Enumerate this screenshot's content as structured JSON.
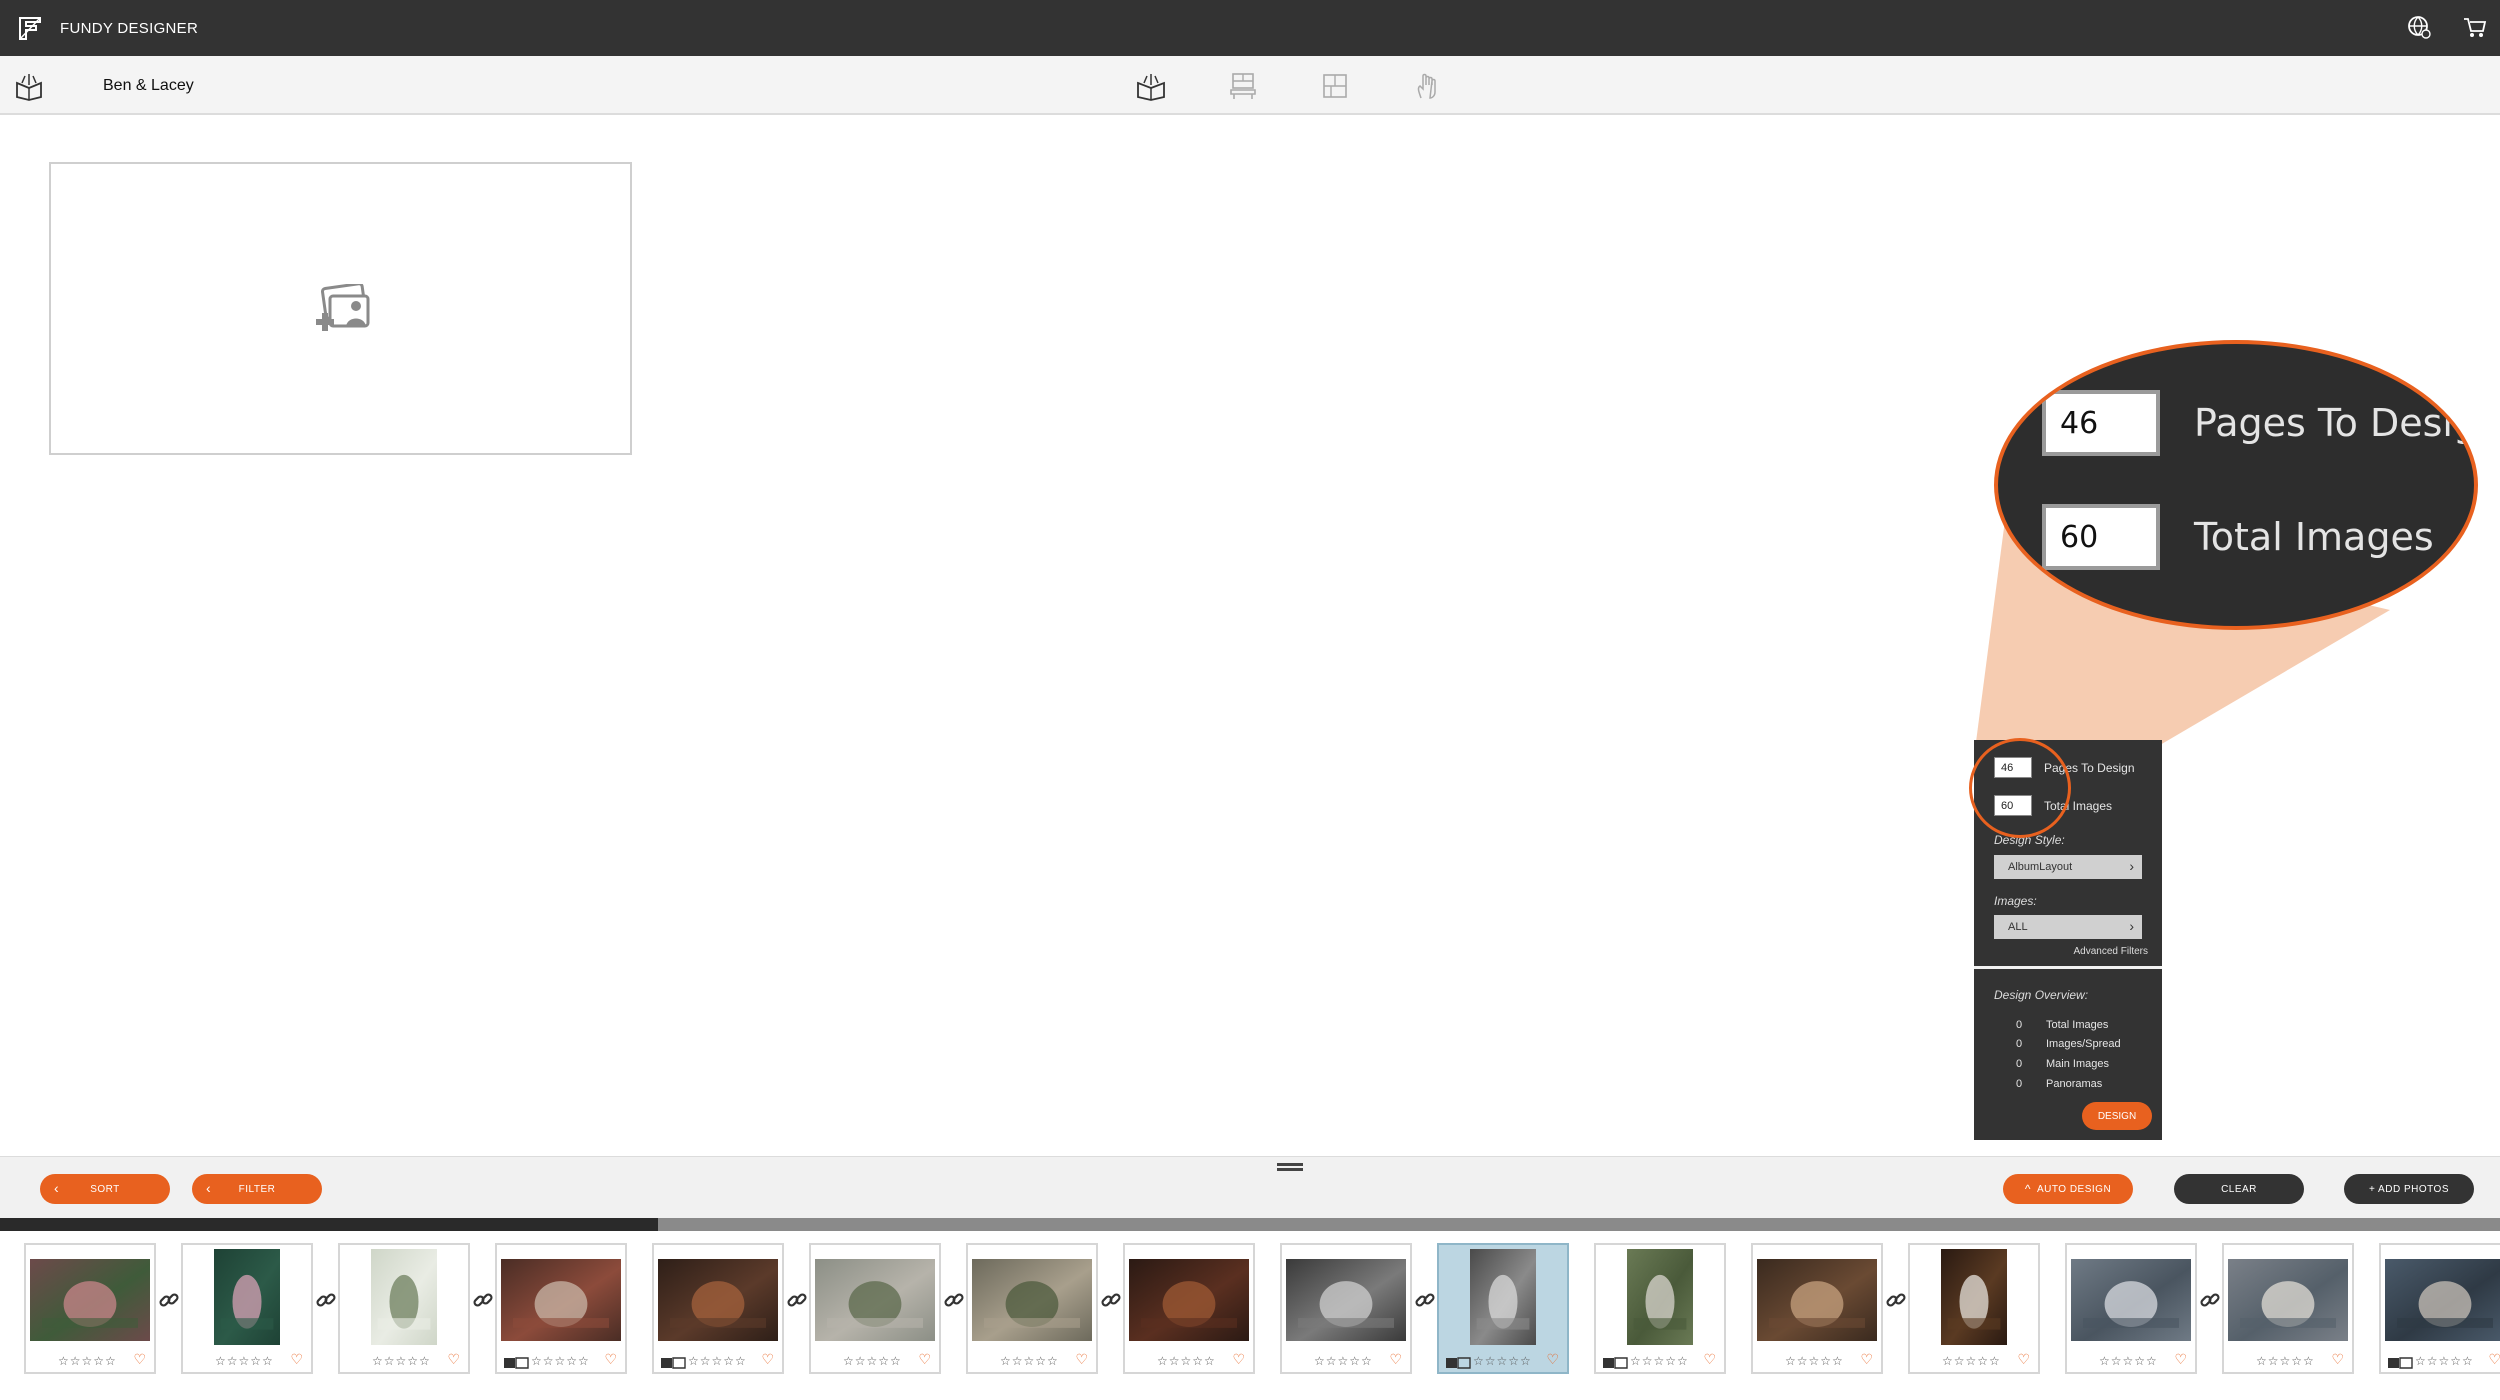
{
  "app": {
    "title": "FUNDY DESIGNER"
  },
  "project": {
    "name": "Ben & Lacey"
  },
  "icons": {
    "app_logo": "fundy-logo-icon",
    "top_right": [
      "help-globe-icon",
      "cart-icon"
    ],
    "album": "album-book-icon",
    "modes": [
      "album-book-icon",
      "wall-art-icon",
      "card-layout-icon",
      "hand-icon"
    ],
    "spread": "add-photos-icon",
    "link": "link-chain-icon"
  },
  "magnifier": {
    "pages_value": "46",
    "pages_label": "Pages To Desig",
    "images_value": "60",
    "images_label": "Total Images"
  },
  "auto_panel": {
    "pages_to_design_value": "46",
    "pages_to_design_label": "Pages To Design",
    "total_images_value": "60",
    "total_images_label": "Total Images",
    "design_style_caption": "Design Style:",
    "design_style_value": "AlbumLayout",
    "images_caption": "Images:",
    "images_value": "ALL",
    "advanced_filters": "Advanced Filters",
    "overview_caption": "Design Overview:",
    "overview": [
      {
        "value": "0",
        "label": "Total Images"
      },
      {
        "value": "0",
        "label": "Images/Spread"
      },
      {
        "value": "0",
        "label": "Main Images"
      },
      {
        "value": "0",
        "label": "Panoramas"
      }
    ],
    "design_button": "DESIGN"
  },
  "toolbar": {
    "sort": "SORT",
    "filter": "FILTER",
    "auto_design": "AUTO DESIGN",
    "clear": "CLEAR",
    "add_photos": "+ ADD PHOTOS"
  },
  "filmstrip": {
    "progress": 0.263,
    "stars": "☆☆☆☆☆",
    "heart": "♡",
    "colors": {
      "accent": "#e8611f",
      "dark": "#333333",
      "selected": "#bcd6e2"
    },
    "thumbs": [
      {
        "name": "flowers-table",
        "orientation": "landscape",
        "linked": true,
        "used": false,
        "selected": false,
        "colors": [
          "#6c4a4a",
          "#c9858b",
          "#3f5b3a"
        ]
      },
      {
        "name": "perfume-bottle",
        "orientation": "portrait",
        "linked": true,
        "used": false,
        "selected": false,
        "colors": [
          "#1e4235",
          "#d8a2b5",
          "#2c5a48"
        ]
      },
      {
        "name": "white-flowers",
        "orientation": "portrait",
        "linked": true,
        "used": false,
        "selected": false,
        "colors": [
          "#cfd6c8",
          "#6e7f5e",
          "#e9ece4"
        ]
      },
      {
        "name": "window-room",
        "orientation": "landscape",
        "linked": false,
        "used": true,
        "selected": false,
        "colors": [
          "#4a2d25",
          "#c9b7a8",
          "#8c4b3b"
        ]
      },
      {
        "name": "barn-hall",
        "orientation": "landscape",
        "linked": true,
        "used": true,
        "selected": false,
        "colors": [
          "#2e1f18",
          "#a4623c",
          "#5b3a2a"
        ]
      },
      {
        "name": "garden-tables",
        "orientation": "landscape",
        "linked": true,
        "used": false,
        "selected": false,
        "colors": [
          "#8c8f86",
          "#5c6a4c",
          "#b6b3aa"
        ]
      },
      {
        "name": "courtyard",
        "orientation": "landscape",
        "linked": true,
        "used": false,
        "selected": false,
        "colors": [
          "#6d6a5c",
          "#4d5b3d",
          "#a89f8c"
        ]
      },
      {
        "name": "reception-hall",
        "orientation": "landscape",
        "linked": false,
        "used": false,
        "selected": false,
        "colors": [
          "#2b1a14",
          "#9d5a34",
          "#5a2f20"
        ]
      },
      {
        "name": "bw-couple",
        "orientation": "landscape",
        "linked": true,
        "used": false,
        "selected": false,
        "colors": [
          "#3a3a3a",
          "#cfcfcf",
          "#7a7a7a"
        ]
      },
      {
        "name": "bw-bride",
        "orientation": "portrait",
        "linked": false,
        "used": true,
        "selected": true,
        "colors": [
          "#4a4a4a",
          "#d9d9d9",
          "#8a8a8a"
        ]
      },
      {
        "name": "garden-couple",
        "orientation": "portrait",
        "linked": false,
        "used": true,
        "selected": false,
        "colors": [
          "#6a7a55",
          "#d9d6cf",
          "#4a5a3a"
        ]
      },
      {
        "name": "guests-table",
        "orientation": "landscape",
        "linked": true,
        "used": false,
        "selected": false,
        "colors": [
          "#3a2a1f",
          "#c7a27f",
          "#6a4a33"
        ]
      },
      {
        "name": "bouquet",
        "orientation": "portrait",
        "linked": false,
        "used": false,
        "selected": false,
        "colors": [
          "#2a1a12",
          "#e7e3dc",
          "#5a3a22"
        ]
      },
      {
        "name": "cake-couple",
        "orientation": "landscape",
        "linked": true,
        "used": false,
        "selected": false,
        "colors": [
          "#6f7a85",
          "#d8dbe0",
          "#4a5560"
        ]
      },
      {
        "name": "cake-cutting",
        "orientation": "landscape",
        "linked": false,
        "used": false,
        "selected": false,
        "colors": [
          "#7a8088",
          "#e1ddd6",
          "#55606a"
        ]
      },
      {
        "name": "guests-group",
        "orientation": "landscape",
        "linked": false,
        "used": true,
        "selected": false,
        "colors": [
          "#4a5a6a",
          "#c9c2b8",
          "#2f3a45"
        ]
      }
    ]
  }
}
